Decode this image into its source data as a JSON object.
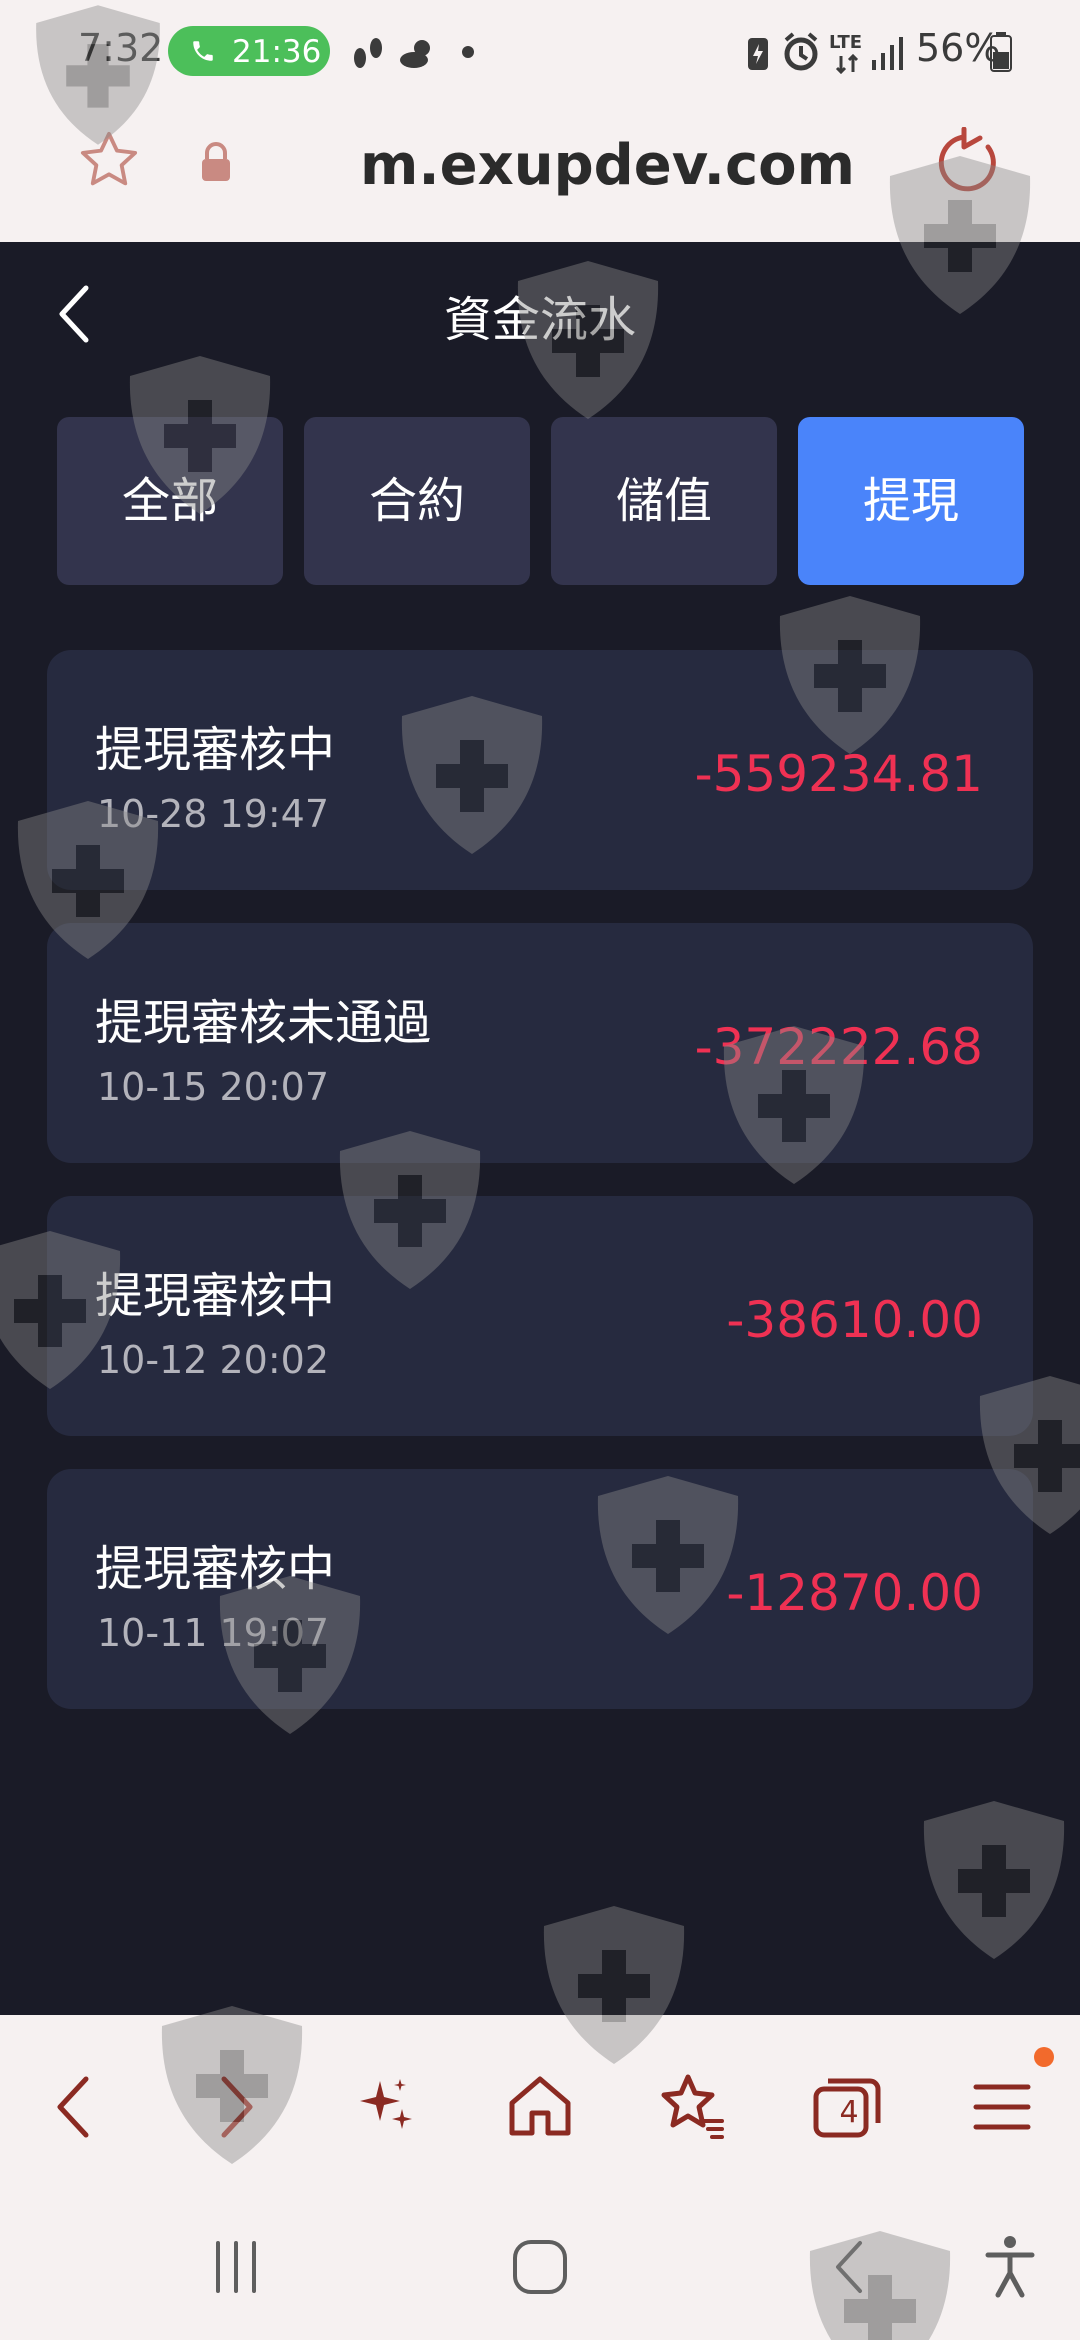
{
  "status_bar": {
    "time": "7:32",
    "call_duration": "21:36",
    "network_type": "LTE",
    "battery": "56%"
  },
  "browser": {
    "url": "m.exupdev.com"
  },
  "header": {
    "title": "資金流水"
  },
  "tabs": [
    {
      "label": "全部",
      "active": false
    },
    {
      "label": "合約",
      "active": false
    },
    {
      "label": "儲值",
      "active": false
    },
    {
      "label": "提現",
      "active": true
    }
  ],
  "records": [
    {
      "status": "提現審核中",
      "time": "10-28 19:47",
      "amount": "-559234.81"
    },
    {
      "status": "提現審核未通過",
      "time": "10-15 20:07",
      "amount": "-372222.68"
    },
    {
      "status": "提現審核中",
      "time": "10-12 20:02",
      "amount": "-38610.00"
    },
    {
      "status": "提現審核中",
      "time": "10-11 19:07",
      "amount": "-12870.00"
    }
  ],
  "browser_nav": {
    "tab_count": "4"
  },
  "colors": {
    "background": "#1a1b27",
    "card": "#262a3f",
    "tab_inactive": "#33344d",
    "tab_active": "#4a84fa",
    "amount_negative": "#ef3153",
    "browser_chrome": "#f6f1f1",
    "browser_icon": "#8b2a22"
  }
}
